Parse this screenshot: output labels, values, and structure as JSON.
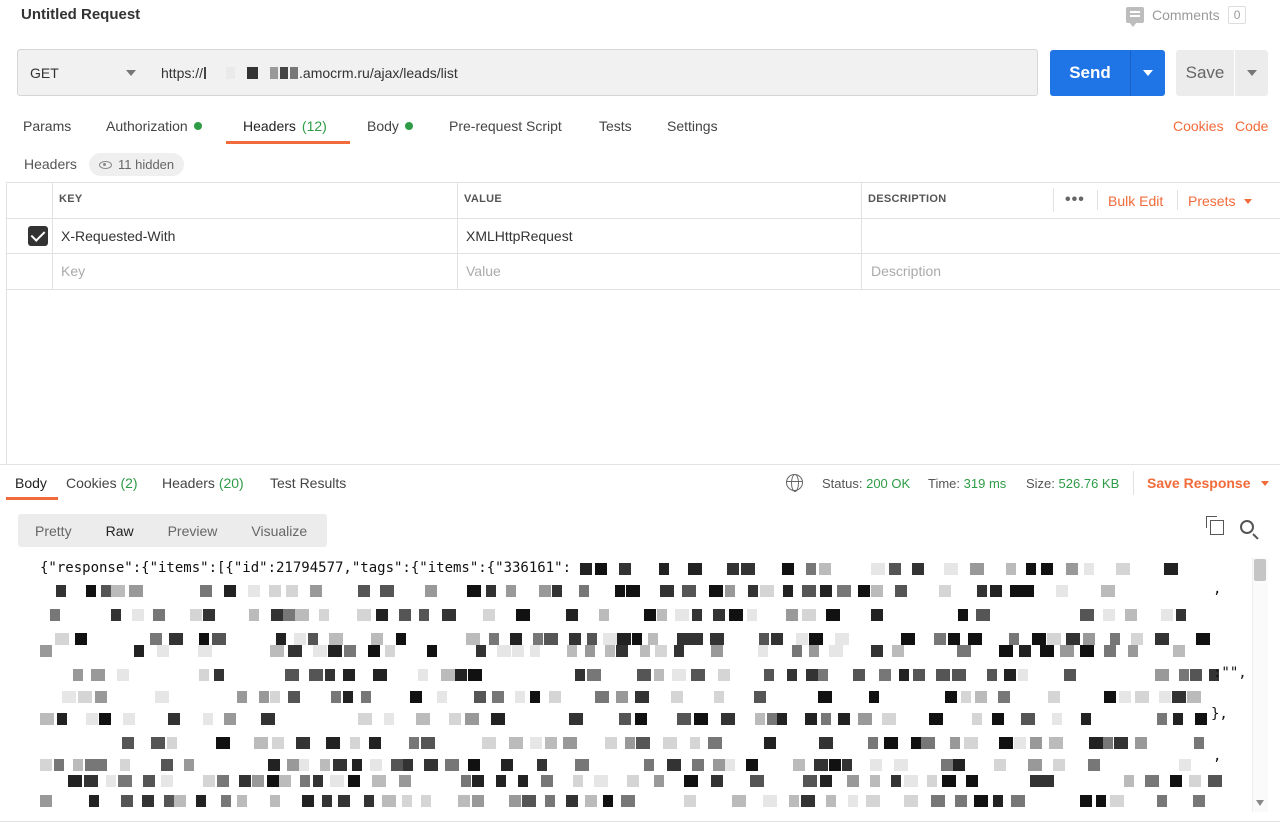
{
  "request": {
    "title": "Untitled Request",
    "comments_label": "Comments",
    "comments_count": "0",
    "method": "GET",
    "url_prefix": "https://",
    "url_suffix": ".amocrm.ru/ajax/leads/list",
    "send_label": "Send",
    "save_label": "Save"
  },
  "tabs": [
    {
      "label": "Params"
    },
    {
      "label": "Authorization"
    },
    {
      "label": "Headers",
      "count": "(12)"
    },
    {
      "label": "Body"
    },
    {
      "label": "Pre-request Script"
    },
    {
      "label": "Tests"
    },
    {
      "label": "Settings"
    }
  ],
  "links": {
    "cookies": "Cookies",
    "code": "Code"
  },
  "headers_section": {
    "label": "Headers",
    "hidden": "11 hidden"
  },
  "table": {
    "columns": [
      "KEY",
      "VALUE",
      "DESCRIPTION"
    ],
    "bulk_edit": "Bulk Edit",
    "presets": "Presets",
    "rows": [
      {
        "key": "X-Requested-With",
        "value": "XMLHttpRequest",
        "description": ""
      }
    ],
    "placeholder": {
      "key": "Key",
      "value": "Value",
      "description": "Description"
    }
  },
  "response": {
    "tabs": [
      {
        "label": "Body"
      },
      {
        "label": "Cookies",
        "count": "(2)"
      },
      {
        "label": "Headers",
        "count": "(20)"
      },
      {
        "label": "Test Results"
      }
    ],
    "status_label": "Status:",
    "status_value": "200 OK",
    "time_label": "Time:",
    "time_value": "319 ms",
    "size_label": "Size:",
    "size_value": "526.76 KB",
    "save_response": "Save Response",
    "modes": [
      "Pretty",
      "Raw",
      "Preview",
      "Visualize"
    ],
    "body_first_line": "{\"response\":{\"items\":[{\"id\":21794577,\"tags\":{\"items\":{\"336161\":",
    "tail_texts": [
      ",",
      ":\"\",",
      "},",
      ","
    ]
  },
  "colors": {
    "accent": "#f26b3a",
    "send": "#1f74e6",
    "ok": "#2e9c46"
  }
}
